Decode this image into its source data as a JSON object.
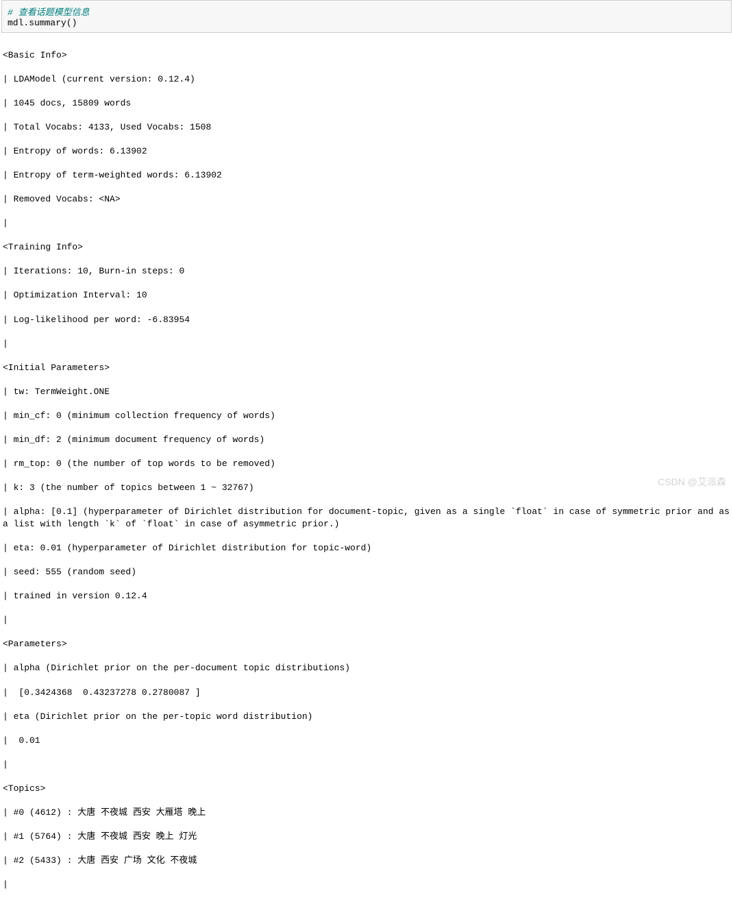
{
  "code": {
    "comment": "# 查看话题模型信息",
    "call": "mdl.summary()"
  },
  "basic_info": {
    "header": "<Basic Info>",
    "model": "| LDAModel (current version: 0.12.4)",
    "docs": "| 1045 docs, 15809 words",
    "vocabs": "| Total Vocabs: 4133, Used Vocabs: 1508",
    "entropy_words": "| Entropy of words: 6.13902",
    "entropy_tw": "| Entropy of term-weighted words: 6.13902",
    "removed": "| Removed Vocabs: <NA>",
    "end": "|"
  },
  "training_info": {
    "header": "<Training Info>",
    "iterations": "| Iterations: 10, Burn-in steps: 0",
    "optimization": "| Optimization Interval: 10",
    "loglik": "| Log-likelihood per word: -6.83954",
    "end": "|"
  },
  "initial_params": {
    "header": "<Initial Parameters>",
    "tw": "| tw: TermWeight.ONE",
    "min_cf": "| min_cf: 0 (minimum collection frequency of words)",
    "min_df": "| min_df: 2 (minimum document frequency of words)",
    "rm_top": "| rm_top: 0 (the number of top words to be removed)",
    "k": "| k: 3 (the number of topics between 1 ~ 32767)",
    "alpha": "| alpha: [0.1] (hyperparameter of Dirichlet distribution for document-topic, given as a single `float` in case of symmetric prior and as a list with length `k` of `float` in case of asymmetric prior.)",
    "eta": "| eta: 0.01 (hyperparameter of Dirichlet distribution for topic-word)",
    "seed": "| seed: 555 (random seed)",
    "trained": "| trained in version 0.12.4",
    "end": "|"
  },
  "parameters": {
    "header": "<Parameters>",
    "alpha_label": "| alpha (Dirichlet prior on the per-document topic distributions)",
    "alpha_values": "|  [0.3424368  0.43237278 0.2780087 ]",
    "eta_label": "| eta (Dirichlet prior on the per-topic word distribution)",
    "eta_value": "|  0.01",
    "end": "|"
  },
  "topics": {
    "header": "<Topics>",
    "t0": "| #0 (4612) : 大唐 不夜城 西安 大雁塔 晚上",
    "t1": "| #1 (5764) : 大唐 不夜城 西安 晚上 灯光",
    "t2": "| #2 (5433) : 大唐 西安 广场 文化 不夜城",
    "end": "|"
  },
  "watermark": "CSDN @艾派森"
}
